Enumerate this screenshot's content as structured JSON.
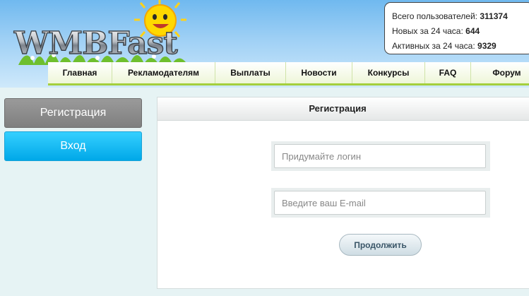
{
  "logo": {
    "text": "WMBFast",
    "icon": "sun-icon"
  },
  "stats": [
    {
      "label": "Всего пользователей:",
      "value": "311374"
    },
    {
      "label": "Новых за 24 часа:",
      "value": "644"
    },
    {
      "label": "Активных за 24 часа:",
      "value": "9329"
    }
  ],
  "menu": [
    {
      "label": "Главная"
    },
    {
      "label": "Рекламодателям"
    },
    {
      "label": "Выплаты"
    },
    {
      "label": "Новости"
    },
    {
      "label": "Конкурсы"
    },
    {
      "label": "FAQ"
    },
    {
      "label": "Форум"
    }
  ],
  "sidebar": {
    "register": "Регистрация",
    "login": "Вход"
  },
  "panel": {
    "title": "Регистрация",
    "login_placeholder": "Придумайте логин",
    "email_placeholder": "Введите ваш E-mail",
    "submit": "Продолжить"
  },
  "colors": {
    "menu_accent": "#a4cf3c",
    "login_button": "#00a8e8",
    "register_button": "#8a8a8a"
  }
}
